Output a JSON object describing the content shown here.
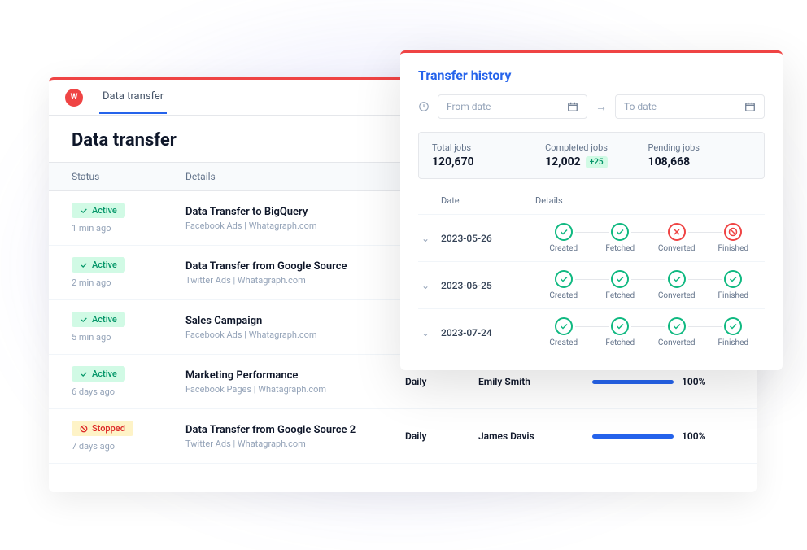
{
  "main": {
    "tab": "Data transfer",
    "page_title": "Data transfer",
    "columns": {
      "status": "Status",
      "details": "Details"
    },
    "rows": [
      {
        "status": "Active",
        "status_kind": "active",
        "ago": "1 min ago",
        "title": "Data Transfer to BigQuery",
        "sub": "Facebook Ads | Whatagraph.com"
      },
      {
        "status": "Active",
        "status_kind": "active",
        "ago": "2 min ago",
        "title": "Data Transfer from Google Source",
        "sub": "Twitter Ads | Whatagraph.com"
      },
      {
        "status": "Active",
        "status_kind": "active",
        "ago": "5 min ago",
        "title": "Sales Campaign",
        "sub": "Facebook Ads | Whatagraph.com"
      },
      {
        "status": "Active",
        "status_kind": "active",
        "ago": "6 days ago",
        "title": "Marketing Performance",
        "sub": "Facebook Pages | Whatagraph.com",
        "freq": "Daily",
        "owner": "Emily Smith",
        "progress": 100,
        "pct": "100%"
      },
      {
        "status": "Stopped",
        "status_kind": "stopped",
        "ago": "7 days ago",
        "title": "Data Transfer from Google Source 2",
        "sub": "Twitter Ads | Whatagraph.com",
        "freq": "Daily",
        "owner": "James Davis",
        "progress": 100,
        "pct": "100%"
      }
    ]
  },
  "panel": {
    "title": "Transfer history",
    "from_placeholder": "From date",
    "to_placeholder": "To date",
    "stats": {
      "total_label": "Total jobs",
      "total_value": "120,670",
      "completed_label": "Completed jobs",
      "completed_value": "12,002",
      "completed_delta": "+25",
      "pending_label": "Pending jobs",
      "pending_value": "108,668"
    },
    "hist_columns": {
      "date": "Date",
      "details": "Details"
    },
    "step_labels": [
      "Created",
      "Fetched",
      "Converted",
      "Finished"
    ],
    "history": [
      {
        "date": "2023-05-26",
        "steps": [
          "ok",
          "ok",
          "fail",
          "fail"
        ]
      },
      {
        "date": "2023-06-25",
        "steps": [
          "ok",
          "ok",
          "ok",
          "ok"
        ]
      },
      {
        "date": "2023-07-24",
        "steps": [
          "ok",
          "ok",
          "ok",
          "ok"
        ]
      }
    ]
  }
}
